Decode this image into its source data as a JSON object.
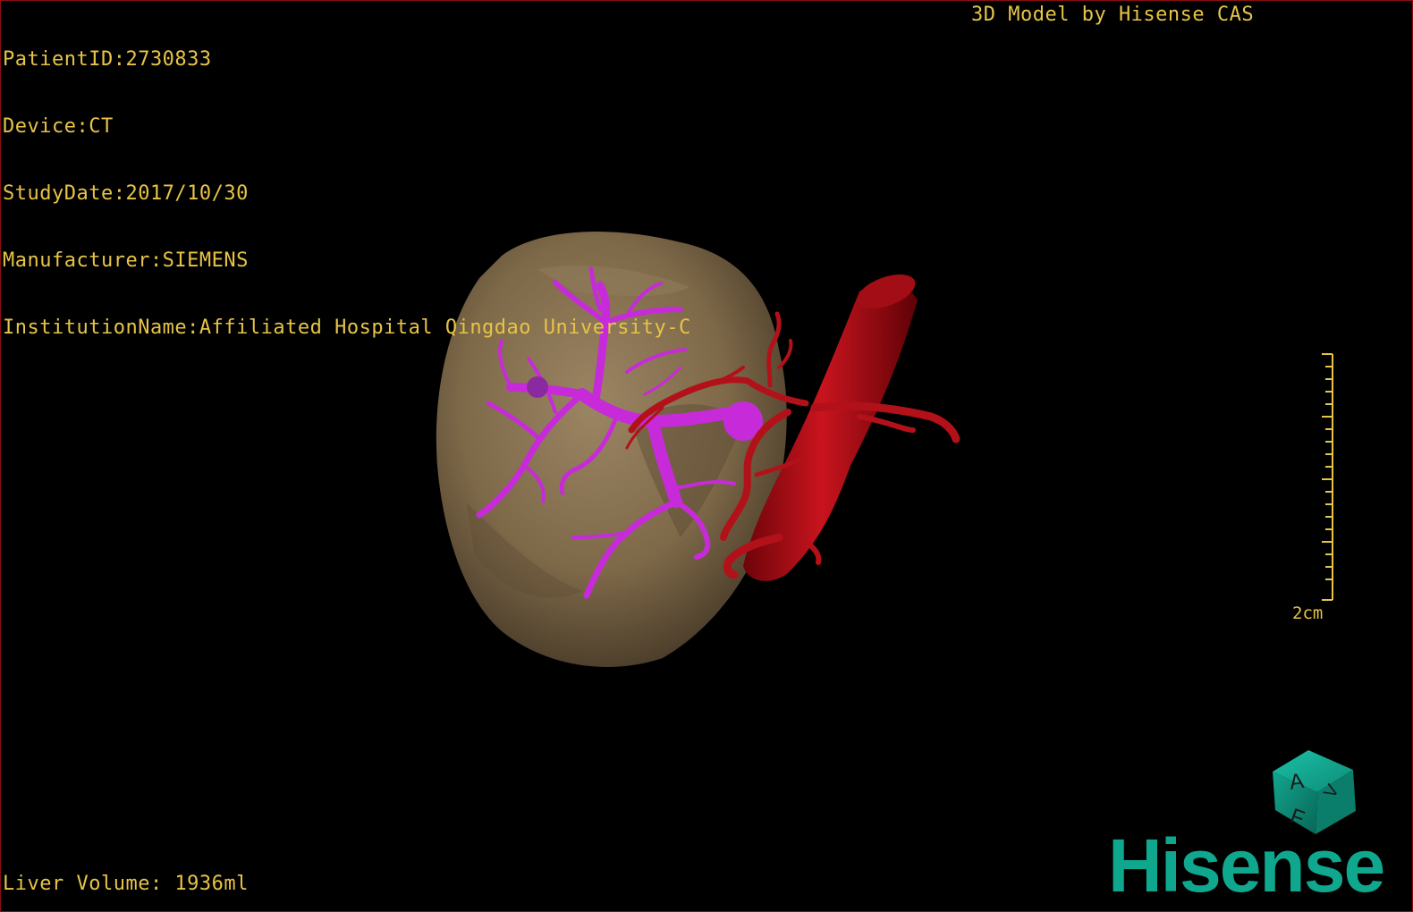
{
  "study_info": {
    "patient_id": "PatientID:2730833",
    "device": "Device:CT",
    "study_date": "StudyDate:2017/10/30",
    "manufacturer": "Manufacturer:SIEMENS",
    "institution": "InstitutionName:Affiliated Hospital Qingdao University-C"
  },
  "header_right": "3D Model by Hisense CAS",
  "footer_left": "Liver Volume: 1936ml",
  "scale_bar": {
    "label": "2cm"
  },
  "orientation_cube": {
    "face_top": "A",
    "face_front": "F",
    "face_side": "V"
  },
  "logo": {
    "text": "Hisense"
  },
  "colors": {
    "text": "#e7c447",
    "liver": "#7a6446",
    "portal_vein": "#c72bd9",
    "artery": "#b3111a",
    "logo": "#0fa88f"
  }
}
